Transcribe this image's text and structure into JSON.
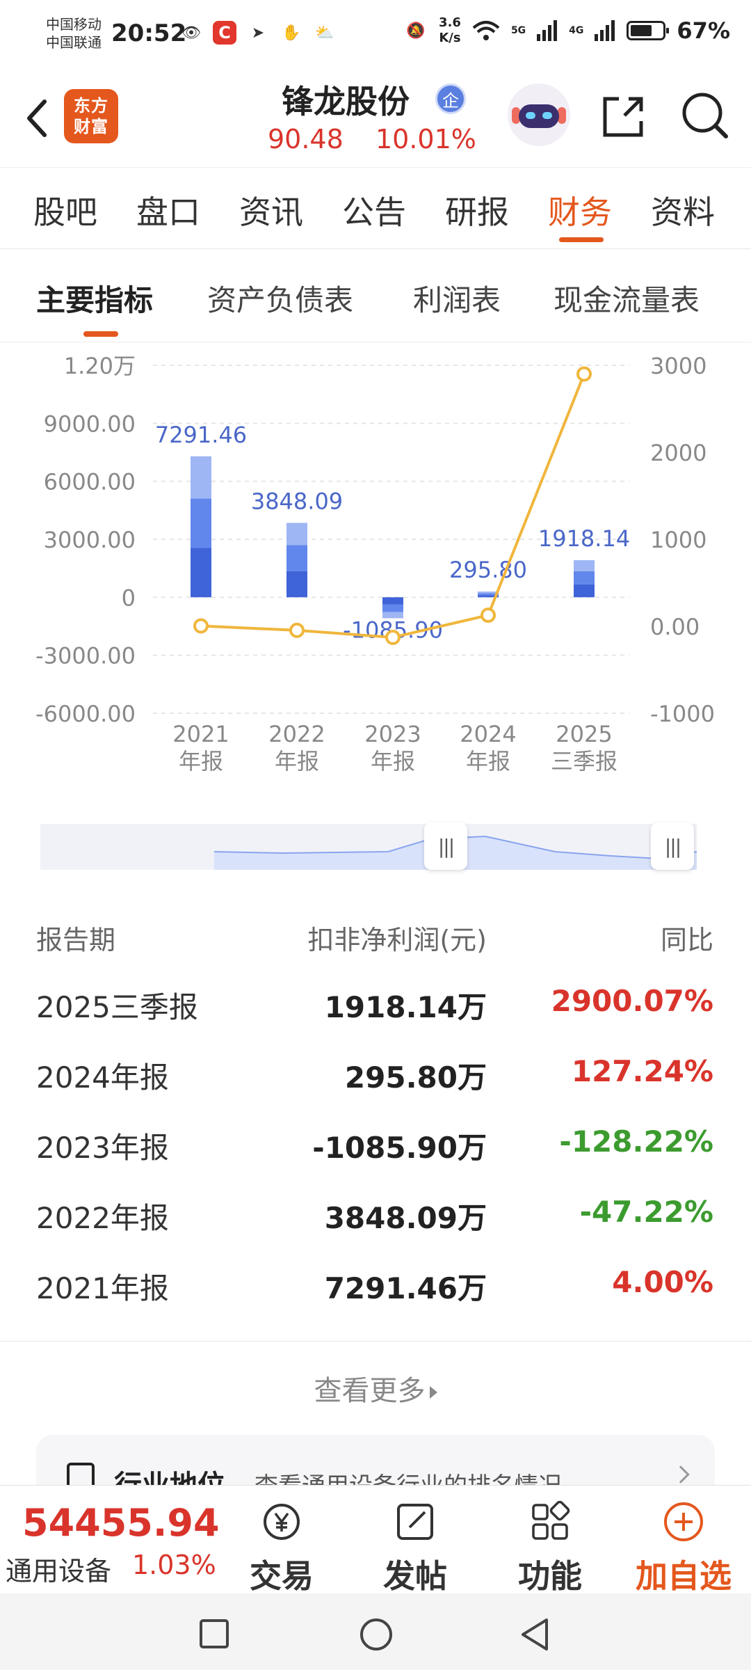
{
  "status_bar": {
    "carrier1": "中国移动",
    "carrier2": "中国联通",
    "time": "20:52",
    "net_speed_value": "3.6",
    "net_speed_unit": "K/s",
    "battery": "67%",
    "net1": "5G",
    "net2": "4G"
  },
  "header": {
    "app_logo": "东方财富",
    "stock_name": "锋龙股份",
    "badge": "企",
    "price": "90.48",
    "change_pct": "10.01%"
  },
  "tabs": [
    "股吧",
    "盘口",
    "资讯",
    "公告",
    "研报",
    "财务",
    "资料"
  ],
  "active_tab": 5,
  "subtabs": [
    "主要指标",
    "资产负债表",
    "利润表",
    "现金流量表"
  ],
  "active_subtab": 0,
  "chart_data": {
    "type": "bar",
    "categories": [
      "2021\n年报",
      "2022\n年报",
      "2023\n年报",
      "2024\n年报",
      "2025\n三季报"
    ],
    "category_line1": [
      "2021",
      "2022",
      "2023",
      "2024",
      "2025"
    ],
    "category_line2": [
      "年报",
      "年报",
      "年报",
      "年报",
      "三季报"
    ],
    "series": [
      {
        "name": "扣非净利润(万元)",
        "values": [
          7291.46,
          3848.09,
          -1085.9,
          295.8,
          1918.14
        ],
        "value_labels": [
          "7291.46",
          "3848.09",
          "-1085.90",
          "295.80",
          "1918.14"
        ],
        "axis": "left"
      },
      {
        "name": "同比(%)",
        "values": [
          4.0,
          -47.22,
          -128.22,
          127.24,
          2900.07
        ],
        "axis": "right",
        "type": "line"
      }
    ],
    "left_ticks": [
      "1.20万",
      "9000.00",
      "6000.00",
      "3000.00",
      "0",
      "-3000.00",
      "-6000.00"
    ],
    "right_ticks": [
      "3000",
      "2000",
      "1000",
      "0.00",
      "-1000"
    ],
    "ylim_left": [
      -6000,
      12000
    ],
    "ylim_right": [
      -1000,
      3000
    ],
    "grid": true,
    "colors": {
      "bar_dark": "#3f63d8",
      "bar_mid": "#6287ec",
      "bar_light": "#9fb6f5",
      "line": "#f0b63c",
      "label": "#4a67c8"
    }
  },
  "table": {
    "headers": [
      "报告期",
      "扣非净利润(元)",
      "同比"
    ],
    "rows": [
      {
        "period": "2025三季报",
        "value": "1918.14万",
        "yoy": "2900.07%",
        "trend": "up"
      },
      {
        "period": "2024年报",
        "value": "295.80万",
        "yoy": "127.24%",
        "trend": "up"
      },
      {
        "period": "2023年报",
        "value": "-1085.90万",
        "yoy": "-128.22%",
        "trend": "down"
      },
      {
        "period": "2022年报",
        "value": "3848.09万",
        "yoy": "-47.22%",
        "trend": "down"
      },
      {
        "period": "2021年报",
        "value": "7291.46万",
        "yoy": "4.00%",
        "trend": "up"
      }
    ]
  },
  "more": {
    "label": "查看更多"
  },
  "industry": {
    "title": "行业地位",
    "desc": "查看通用设备行业的排名情况"
  },
  "bottom": {
    "index_value": "54455.94",
    "index_name": "通用设备",
    "index_pct": "1.03%",
    "trade": "交易",
    "post": "发帖",
    "func": "功能",
    "add": "加自选"
  },
  "colors": {
    "accent": "#e4571d",
    "up": "#d9342b",
    "down": "#3c9b2f"
  }
}
